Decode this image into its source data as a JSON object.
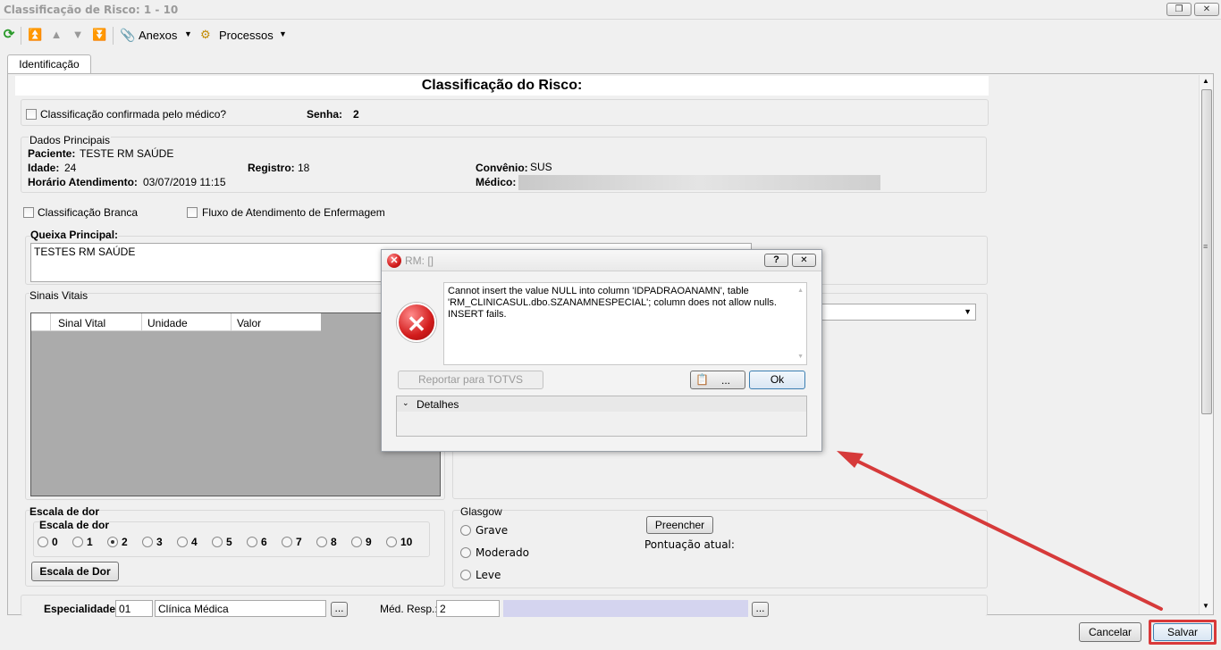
{
  "window": {
    "title": "Classificação de Risco: 1 - 10"
  },
  "toolbar": {
    "anexos": "Anexos",
    "processos": "Processos"
  },
  "tabs": [
    {
      "label": "Identificação"
    }
  ],
  "form": {
    "heading": "Classificação do Risco:",
    "confirmed_label": "Classificação confirmada pelo médico?",
    "senha_label": "Senha:",
    "senha_value": "2",
    "dados_title": "Dados Principais",
    "paciente_label": "Paciente:",
    "paciente_value": "TESTE RM SAÚDE",
    "idade_label": "Idade:",
    "idade_value": "24",
    "registro_label": "Registro:",
    "registro_value": "18",
    "convenio_label": "Convênio:",
    "convenio_value": "SUS",
    "horario_label": "Horário Atendimento:",
    "horario_value": "03/07/2019 11:15",
    "medico_label": "Médico:",
    "classificacao_branca": "Classificação Branca",
    "fluxo_label": "Fluxo de Atendimento de Enfermagem",
    "queixa_label": "Queixa Principal:",
    "queixa_value": "TESTES RM SAÚDE",
    "sinais_title": "Sinais Vitais",
    "sinais_columns": [
      "Sinal Vital",
      "Unidade",
      "Valor"
    ],
    "dor_title": "Escala de dor",
    "dor_inner_title": "Escala de dor",
    "dor_options": [
      "0",
      "1",
      "2",
      "3",
      "4",
      "5",
      "6",
      "7",
      "8",
      "9",
      "10"
    ],
    "dor_selected": "2",
    "dor_button": "Escala de Dor",
    "glasgow_title": "Glasgow",
    "glasgow_options": [
      "Grave",
      "Moderado",
      "Leve"
    ],
    "preencher_button": "Preencher",
    "pontuacao_label": "Pontuação atual:",
    "especialidade_label": "Especialidade:",
    "especialidade_code": "01",
    "especialidade_name": "Clínica Médica",
    "ellipsis": "...",
    "med_resp_label": "Méd. Resp.:",
    "med_resp_value": "2"
  },
  "dialog": {
    "title": "RM: []",
    "help": "?",
    "message": "Cannot insert the value NULL into column 'IDPADRAOANAMN', table 'RM_CLINICASUL.dbo.SZANAMNESPECIAL'; column does not allow nulls. INSERT fails.",
    "report_button": "Reportar para TOTVS",
    "more_button": "...",
    "ok_button": "Ok",
    "details_label": "Detalhes"
  },
  "footer": {
    "cancel": "Cancelar",
    "save": "Salvar"
  },
  "colors": {
    "highlight": "#d9393a",
    "arrow": "#d63a3a",
    "grid_bg": "#ababab"
  }
}
